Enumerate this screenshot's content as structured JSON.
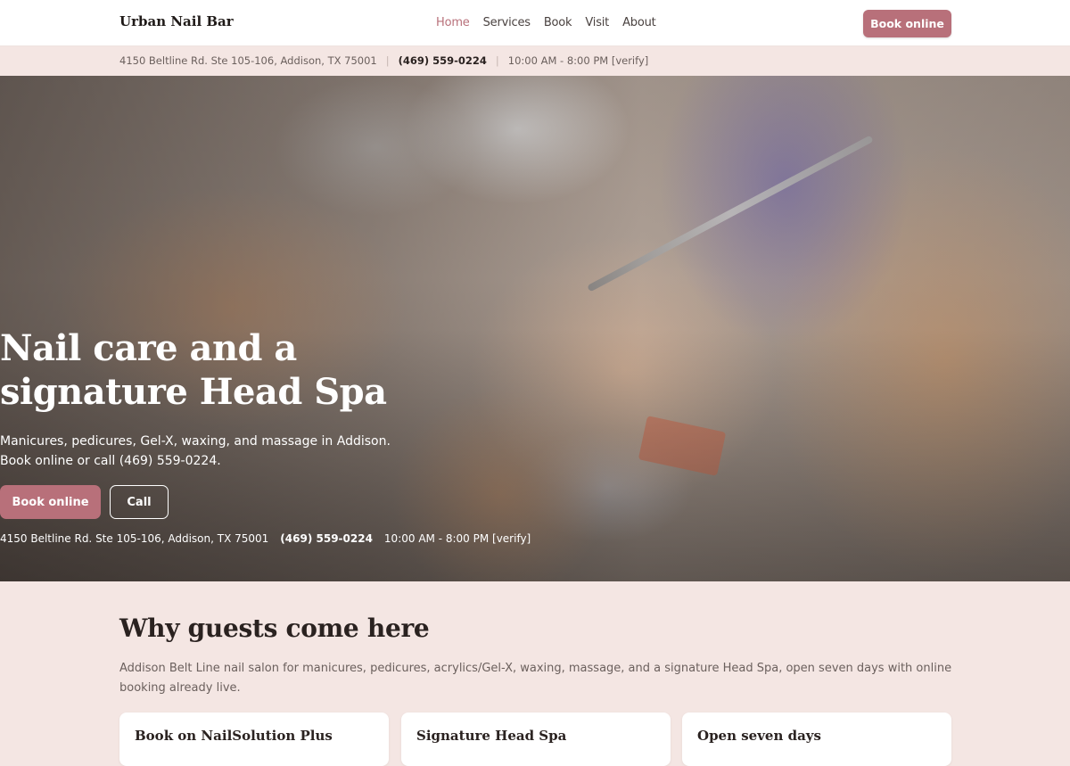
{
  "header": {
    "brand": "Urban Nail Bar",
    "nav": [
      "Home",
      "Services",
      "Book",
      "Visit",
      "About"
    ],
    "active_nav": "Home",
    "cta_label": "Book online"
  },
  "infobar": {
    "address": "4150 Beltline Rd. Ste 105-106, Addison, TX 75001",
    "phone": "(469) 559-0224",
    "hours": "10:00 AM - 8:00 PM [verify]"
  },
  "hero": {
    "title_line1": "Nail care and a",
    "title_line2": "signature Head Spa",
    "sub_line1": "Manicures, pedicures, Gel-X, waxing, and massage in Addison.",
    "sub_line2": "Book online or call (469) 559-0224.",
    "book_label": "Book online",
    "call_label": "Call",
    "address": "4150 Beltline Rd. Ste 105-106, Addison, TX 75001",
    "phone": "(469) 559-0224",
    "hours": "10:00 AM - 8:00 PM [verify]"
  },
  "why": {
    "title": "Why guests come here",
    "description": "Addison Belt Line nail salon for manicures, pedicures, acrylics/Gel-X, waxing, massage, and a signature Head Spa, open seven days with online booking already live.",
    "cards": [
      "Book on NailSolution Plus",
      "Signature Head Spa",
      "Open seven days"
    ]
  },
  "colors": {
    "accent": "#b8707a",
    "page_background": "#f4e6e3",
    "heading_text": "#2a2220"
  }
}
